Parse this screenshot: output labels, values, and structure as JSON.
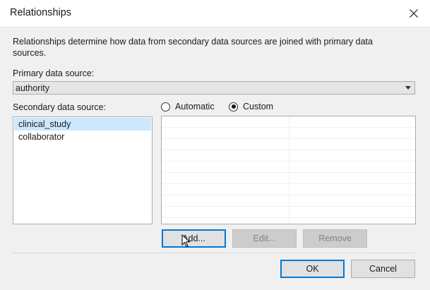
{
  "window": {
    "title": "Relationships",
    "close_icon": "close-icon"
  },
  "description": "Relationships determine how data from secondary data sources are joined with primary data sources.",
  "primary": {
    "label": "Primary data source:",
    "selected": "authority"
  },
  "secondary": {
    "label": "Secondary data source:",
    "items": [
      {
        "label": "clinical_study",
        "selected": true
      },
      {
        "label": "collaborator",
        "selected": false
      }
    ]
  },
  "mode": {
    "automatic_label": "Automatic",
    "custom_label": "Custom",
    "selected": "Custom"
  },
  "actions": {
    "add_label": "Add...",
    "edit_label": "Edit...",
    "remove_label": "Remove"
  },
  "footer": {
    "ok_label": "OK",
    "cancel_label": "Cancel"
  },
  "colors": {
    "accent": "#0078d7",
    "selection": "#cce8ff"
  }
}
